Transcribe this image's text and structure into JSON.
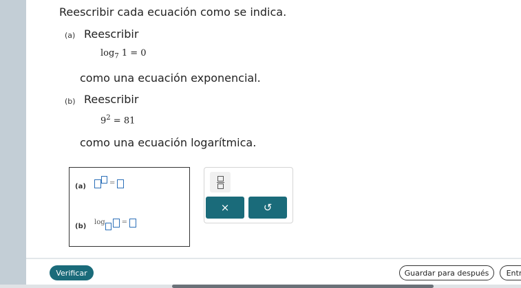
{
  "instruction": "Reescribir cada ecuación como se indica.",
  "part_a": {
    "label": "(a)",
    "title": "Reescribir",
    "eq_base": "log",
    "eq_sub": "7",
    "eq_rest": "1 = 0",
    "text": "como una ecuación exponencial."
  },
  "part_b": {
    "label": "(b)",
    "title": "Reescribir",
    "eq_base": "9",
    "eq_sup": "2",
    "eq_rest": "= 81",
    "text": "como una ecuación logarítmica."
  },
  "answer": {
    "a_label": "(a)",
    "b_label": "(b)",
    "eq_sign": "=",
    "log": "log"
  },
  "palette": {
    "clear": "×",
    "undo": "↺"
  },
  "footer": {
    "verify": "Verificar",
    "save": "Guardar para después",
    "submit": "Entr"
  },
  "colors": {
    "accent": "#1a6b7a",
    "input_border": "#2b6fb8",
    "left_bar": "#c3ced6"
  }
}
